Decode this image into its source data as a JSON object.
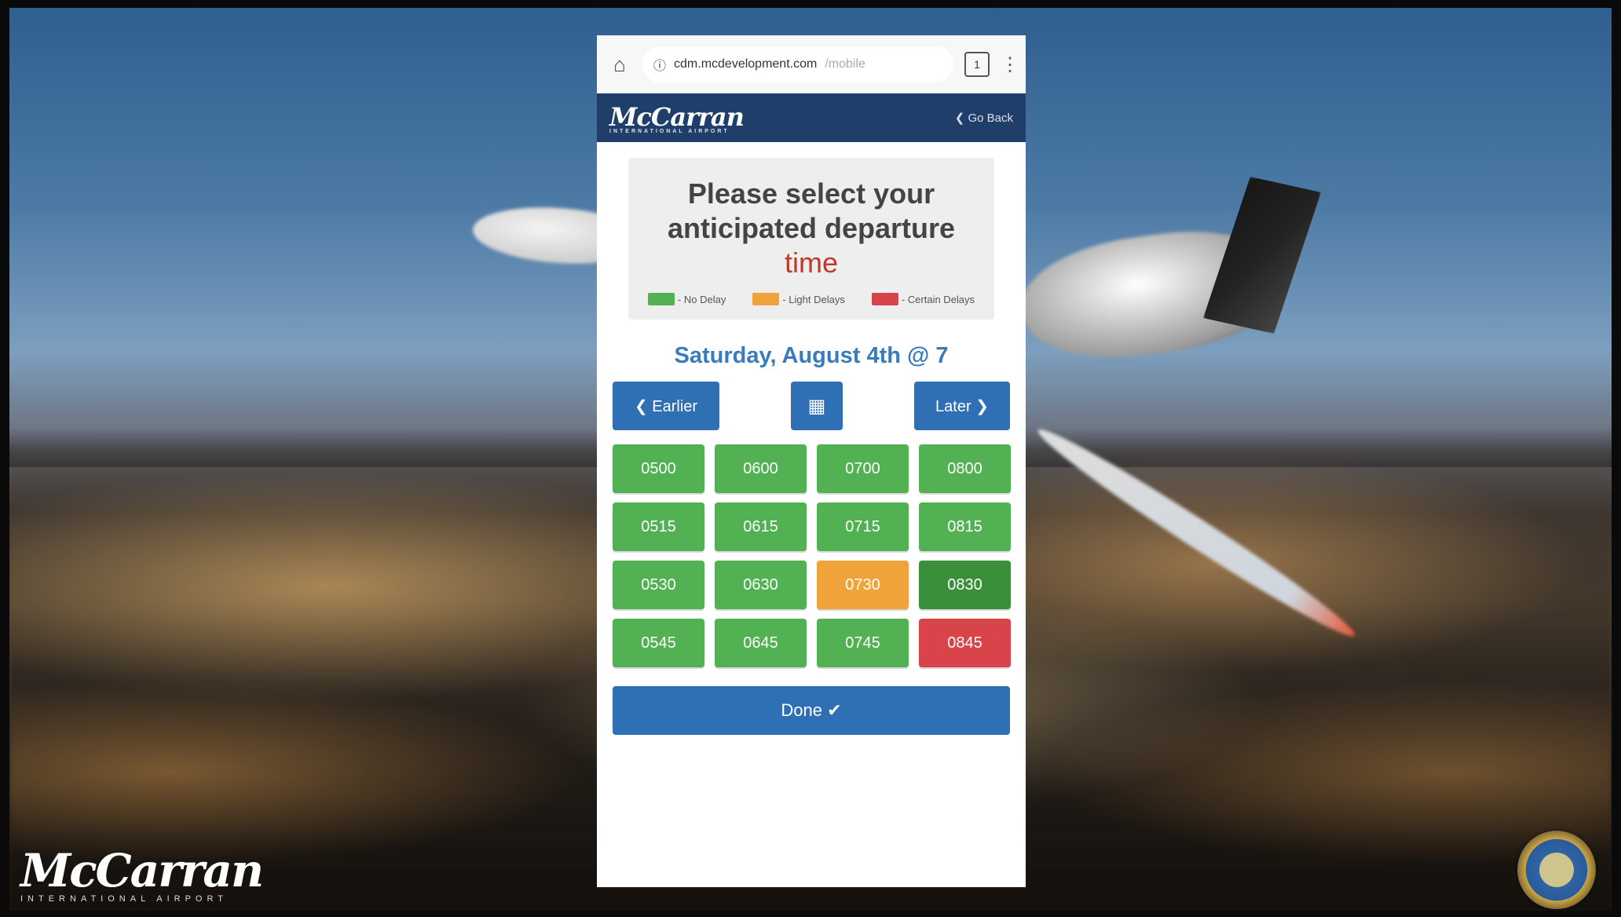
{
  "colors": {
    "green": "#52b152",
    "orange": "#f0a33a",
    "red": "#d9434a",
    "dark_green": "#3a8f3a",
    "blue": "#2f6fb3",
    "navy": "#1f3e6a"
  },
  "background": {
    "logo_text": "McCarran",
    "logo_sub": "INTERNATIONAL AIRPORT",
    "seal_icon": "faa-seal-icon"
  },
  "browser": {
    "address": "cdm.mcdevelopment.com",
    "address_path": "/mobile",
    "tabs_count": "1"
  },
  "appbar": {
    "brand": "McCarran",
    "brand_sub": "INTERNATIONAL AIRPORT",
    "back_label": "❮ Go Back"
  },
  "prompt": {
    "line1": "Please select your",
    "line2": "anticipated departure",
    "line3": "time"
  },
  "legend": [
    {
      "label": "- No Delay",
      "color": "#52b152"
    },
    {
      "label": "- Light Delays",
      "color": "#f0a33a"
    },
    {
      "label": "- Certain Delays",
      "color": "#d9434a"
    }
  ],
  "date_label": "Saturday, August 4th @ 7",
  "nav": {
    "earlier": "❮ Earlier",
    "calendar_icon": "calendar-icon",
    "later": "Later ❯"
  },
  "slots": [
    {
      "time": "0500",
      "status": "green"
    },
    {
      "time": "0600",
      "status": "green"
    },
    {
      "time": "0700",
      "status": "green"
    },
    {
      "time": "0800",
      "status": "green"
    },
    {
      "time": "0515",
      "status": "green"
    },
    {
      "time": "0615",
      "status": "green"
    },
    {
      "time": "0715",
      "status": "green"
    },
    {
      "time": "0815",
      "status": "green"
    },
    {
      "time": "0530",
      "status": "green"
    },
    {
      "time": "0630",
      "status": "green"
    },
    {
      "time": "0730",
      "status": "orange"
    },
    {
      "time": "0830",
      "status": "dark_green"
    },
    {
      "time": "0545",
      "status": "green"
    },
    {
      "time": "0645",
      "status": "green"
    },
    {
      "time": "0745",
      "status": "green"
    },
    {
      "time": "0845",
      "status": "red"
    }
  ],
  "done_label": "Done ✔"
}
